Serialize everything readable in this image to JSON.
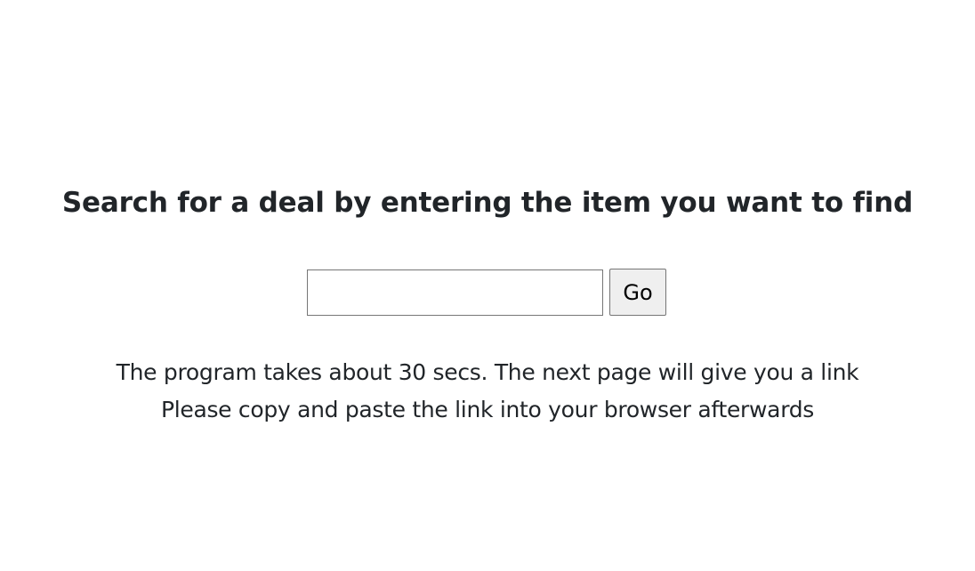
{
  "heading": "Search for a deal by entering the item you want to find",
  "search": {
    "value": "",
    "placeholder": "",
    "button_label": "Go"
  },
  "info": {
    "line1": "The program takes about 30 secs. The next page will give you a link",
    "line2": "Please copy and paste the link into your browser afterwards"
  }
}
